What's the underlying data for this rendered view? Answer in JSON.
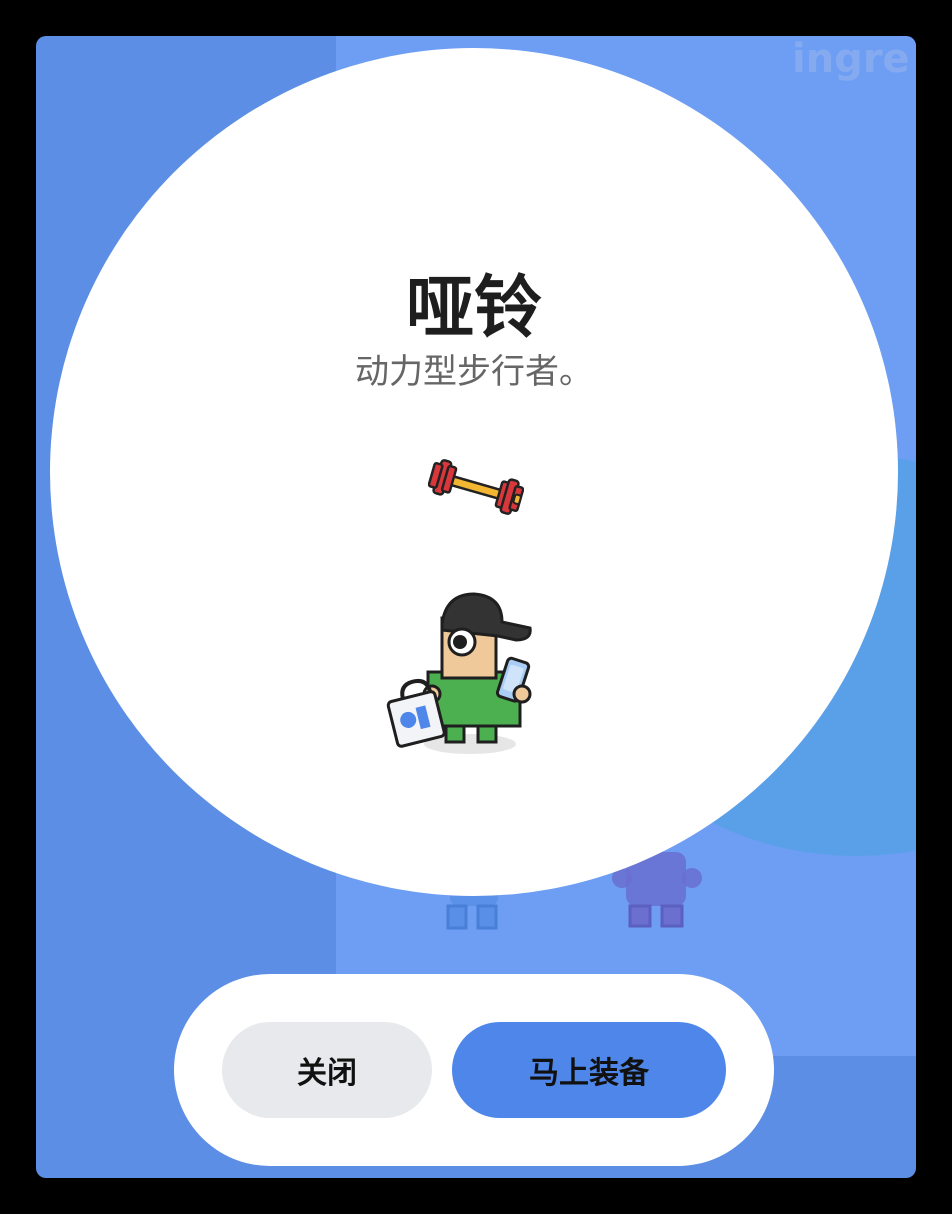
{
  "dialog": {
    "title": "哑铃",
    "subtitle": "动力型步行者。",
    "item_icon": "dumbbell-icon",
    "character_icon": "walker-avatar"
  },
  "buttons": {
    "close_label": "关闭",
    "equip_label": "马上装备"
  },
  "background": {
    "logo_text": "ingre"
  },
  "colors": {
    "accent": "#4f86ea",
    "backdrop": "#5b8ee4",
    "close_button": "#e8e9ec"
  }
}
